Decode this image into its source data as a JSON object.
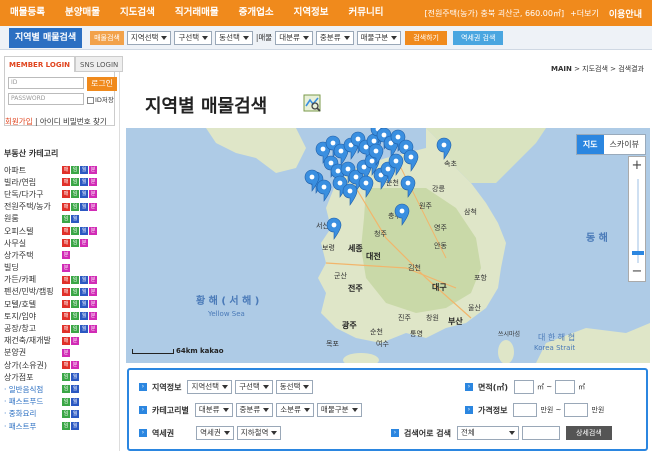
{
  "topnav": {
    "items": [
      "매물등록",
      "분양매물",
      "지도검색",
      "직거래매물",
      "중개업소",
      "지역정보",
      "커뮤니티"
    ],
    "ticker": "[전원주택(농가) 충북 괴산군, 660.00㎡]",
    "more": "+더보기",
    "guide": "이용안내"
  },
  "subbar": {
    "title": "지역별 매물검색",
    "tag": "매물검색",
    "selects": [
      "지역선택",
      "구선택",
      "동선택"
    ],
    "label": "|매물",
    "type_selects": [
      "대분류",
      "중분류",
      "매물구분"
    ],
    "search_btn": "검색하기",
    "station_btn": "역세권 검색"
  },
  "login": {
    "tab_member": "MEMBER LOGIN",
    "tab_sns": "SNS LOGIN",
    "id_placeholder": "ID",
    "pw_placeholder": "PASSWORD",
    "login_btn": "로그인",
    "remember": "ID저장",
    "join": "회원가입",
    "find": "| 아이디 비밀번호 찾기"
  },
  "categories": {
    "heading": "부동산 카테고리",
    "items": [
      {
        "name": "아파트",
        "badges": [
          "r",
          "g",
          "b",
          "p"
        ],
        "sub": false
      },
      {
        "name": "빌라/연립",
        "badges": [
          "r",
          "g",
          "b",
          "p"
        ],
        "sub": false
      },
      {
        "name": "단독/다가구",
        "badges": [
          "r",
          "g",
          "b",
          "p"
        ],
        "sub": false
      },
      {
        "name": "전원주택/농가",
        "badges": [
          "r",
          "g",
          "b",
          "p"
        ],
        "sub": false
      },
      {
        "name": "원룸",
        "badges": [
          "g",
          "b"
        ],
        "sub": false
      },
      {
        "name": "오피스텔",
        "badges": [
          "r",
          "g",
          "b",
          "p"
        ],
        "sub": false
      },
      {
        "name": "사무실",
        "badges": [
          "r",
          "g",
          "p"
        ],
        "sub": false
      },
      {
        "name": "상가주택",
        "badges": [
          "p"
        ],
        "sub": false
      },
      {
        "name": "빌딩",
        "badges": [
          "p"
        ],
        "sub": false
      },
      {
        "name": "가든/카페",
        "badges": [
          "r",
          "g",
          "b",
          "p"
        ],
        "sub": false
      },
      {
        "name": "펜션/민박/캠핑",
        "badges": [
          "r",
          "g",
          "b",
          "p"
        ],
        "sub": false
      },
      {
        "name": "모텔/호텔",
        "badges": [
          "r",
          "g",
          "b",
          "p"
        ],
        "sub": false
      },
      {
        "name": "토지/임야",
        "badges": [
          "r",
          "g",
          "b",
          "p"
        ],
        "sub": false
      },
      {
        "name": "공장/창고",
        "badges": [
          "r",
          "g",
          "b",
          "p"
        ],
        "sub": false
      },
      {
        "name": "재건축/재개발",
        "badges": [
          "r",
          "p"
        ],
        "sub": false
      },
      {
        "name": "분양권",
        "badges": [
          "p"
        ],
        "sub": false
      },
      {
        "name": "상가(소유권)",
        "badges": [
          "r",
          "p"
        ],
        "sub": false
      },
      {
        "name": "상가점포",
        "badges": [
          "g",
          "b"
        ],
        "sub": false
      },
      {
        "name": "· 일반음식점",
        "badges": [
          "g",
          "b"
        ],
        "sub": true
      },
      {
        "name": "· 패스트푸드",
        "badges": [
          "g",
          "b"
        ],
        "sub": true
      },
      {
        "name": "· 중화요리",
        "badges": [
          "g",
          "b"
        ],
        "sub": true
      },
      {
        "name": "· 패스트푸",
        "badges": [
          "g",
          "b"
        ],
        "sub": true
      }
    ]
  },
  "main": {
    "crumb_main": "MAIN",
    "crumb_rest": " > 지도검색 > 검색결과",
    "title": "지역별 매물검색"
  },
  "map": {
    "tab_map": "지도",
    "tab_sky": "스카이뷰",
    "zoom_in": "+",
    "zoom_out": "−",
    "scale": "64km",
    "brand": "kakao",
    "labels": {
      "yellow_sea": "황 해 ( 서 해 )",
      "yellow_sea_en": "Yellow Sea",
      "east_sea": "동 해",
      "strait": "대 한 해 협",
      "strait_en": "Korea Strait",
      "chuncheon": "춘천",
      "gangneung": "강릉",
      "wonju": "원주",
      "cheongju": "청주",
      "sejong": "세종",
      "daejeon": "대전",
      "jeonju": "전주",
      "gwangju": "광주",
      "daegu": "대구",
      "ulsan": "울산",
      "busan": "부산",
      "pohang": "포항",
      "andong": "안동",
      "gimcheon": "김천",
      "jinju": "진주",
      "mokpo": "목포",
      "gunsan": "군산",
      "boryeong": "보령",
      "seosan": "서산",
      "suncheon": "순천",
      "yeosu": "여수",
      "tongyeong": "통영",
      "changwon": "창원",
      "chungju": "충주",
      "yeongju": "영주",
      "samcheok": "삼척",
      "sokcho": "속초",
      "tsushima": "쓰시마섬"
    }
  },
  "search": {
    "region_label": "지역정보",
    "region_selects": [
      "지역선택",
      "구선택",
      "동선택"
    ],
    "area_label": "면적(㎡)",
    "area_unit": "㎡ ~",
    "area_unit2": "㎡",
    "category_label": "카테고리별",
    "category_selects": [
      "대분류",
      "중분류",
      "소분류",
      "매물구분"
    ],
    "price_label": "가격정보",
    "price_unit": "만원 ~",
    "price_unit2": "만원",
    "station_label": "역세권",
    "station_selects": [
      "역세권",
      "지하철역"
    ],
    "keyword_label": "검색어로 검색",
    "keyword_select": "전체",
    "detail_btn": "상세검색"
  },
  "colors": {
    "nav": "#f08a1c",
    "accent": "#2b86e0",
    "marker": "#3a8fe0"
  }
}
